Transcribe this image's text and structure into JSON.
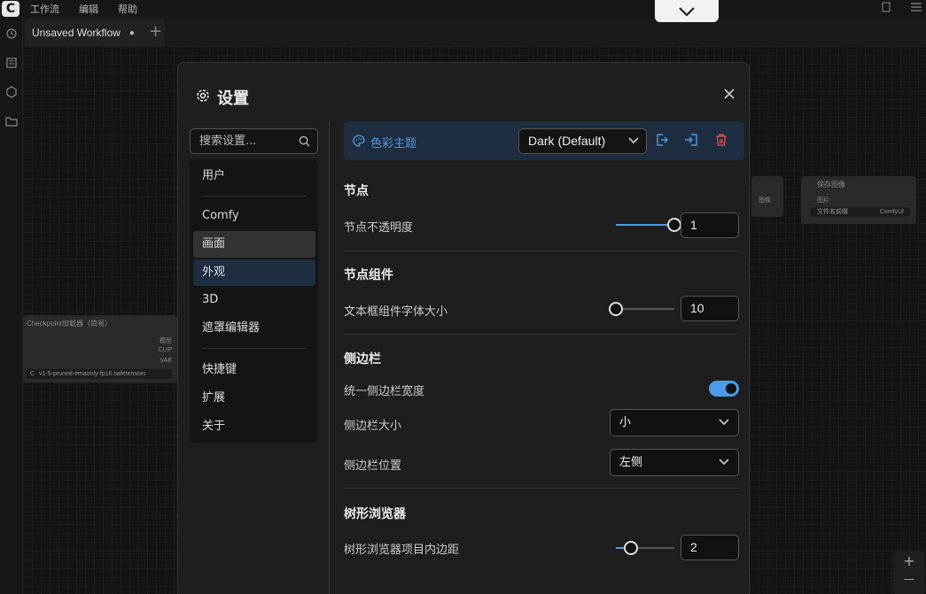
{
  "menubar": {
    "items": [
      "工作流",
      "编辑",
      "帮助"
    ]
  },
  "tabs": [
    {
      "label": "Unsaved Workflow",
      "modified": "●"
    }
  ],
  "tab_add": "+",
  "background_nodes": {
    "checkpoint": {
      "title": "Checkpoint加载器（简易）",
      "outputs": [
        "模型",
        "CLIP",
        "VAE"
      ],
      "model_value": "v1-5-pruned-emaonly-fp16.safetensors",
      "model_prefix": "C"
    },
    "save": {
      "title": "保存图像",
      "input": "图片",
      "prefix_label": "文件名前缀",
      "prefix_value": "ComfyUI"
    },
    "mid": {
      "label": "图像"
    }
  },
  "zoom": {
    "in": "+",
    "out": "—"
  },
  "dialog": {
    "title": "设置",
    "search_placeholder": "搜索设置...",
    "nav": {
      "group1": [
        "用户"
      ],
      "group2": [
        "Comfy",
        "画面",
        "外观",
        "3D",
        "遮罩编辑器"
      ],
      "group3": [
        "快捷键",
        "扩展",
        "关于"
      ],
      "active": "画面",
      "selected": "外观"
    },
    "theme": {
      "label": "色彩主题",
      "value": "Dark (Default)"
    },
    "sections": {
      "node": {
        "title": "节点",
        "opacity_label": "节点不透明度",
        "opacity_value": "1",
        "opacity_fraction": 1.0
      },
      "widget": {
        "title": "节点组件",
        "font_label": "文本框组件字体大小",
        "font_value": "10",
        "font_fraction": 0.0
      },
      "sidebar": {
        "title": "侧边栏",
        "unify_label": "统一侧边栏宽度",
        "unify_on": true,
        "size_label": "侧边栏大小",
        "size_value": "小",
        "pos_label": "侧边栏位置",
        "pos_value": "左侧"
      },
      "tree": {
        "title": "树形浏览器",
        "padding_label": "树形浏览器项目内边距",
        "padding_value": "2",
        "padding_fraction": 0.25
      }
    }
  },
  "colors": {
    "accent": "#4a9be8",
    "danger": "#e05555",
    "panel": "#1e1e1e",
    "selected_bg": "#1f2d40"
  }
}
